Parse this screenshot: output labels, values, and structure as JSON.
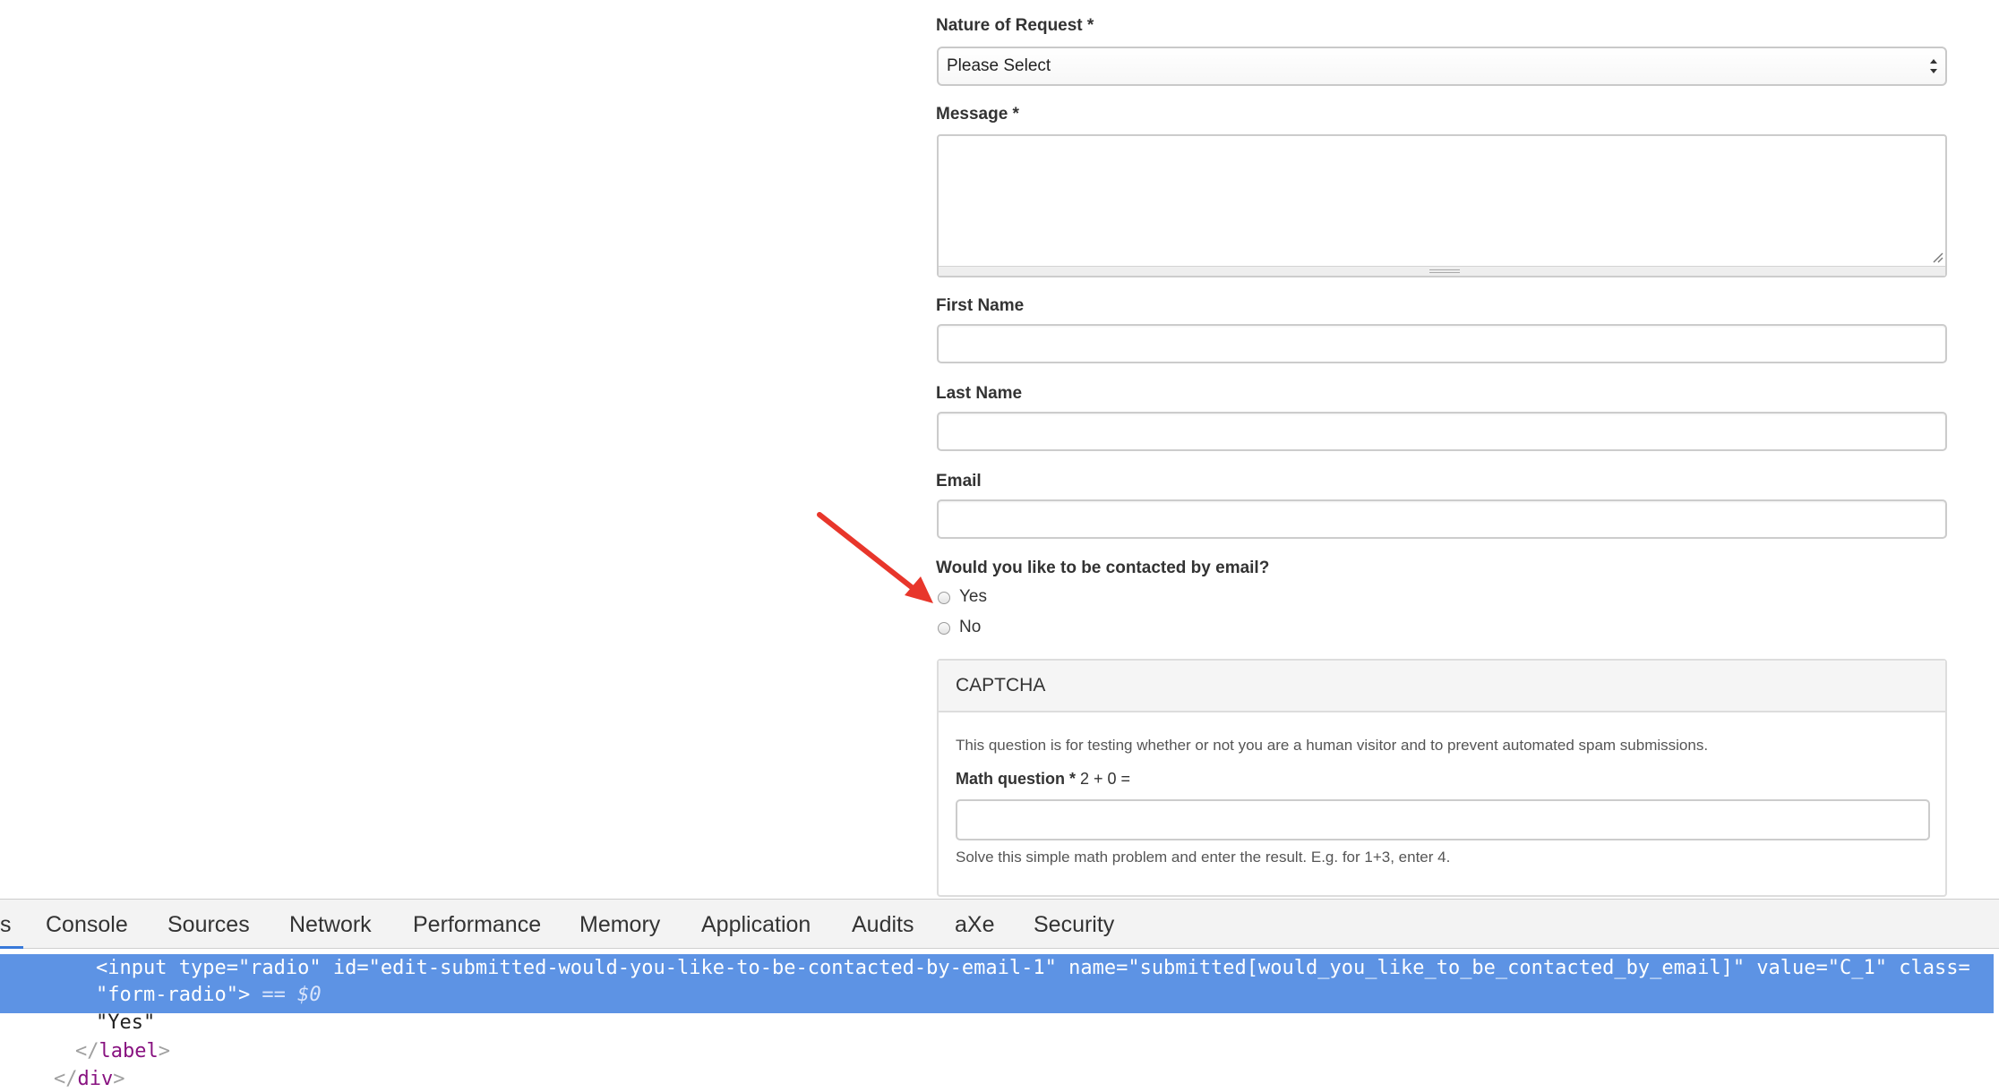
{
  "form": {
    "nature_label": "Nature of Request *",
    "nature_select_value": "Please Select",
    "message_label": "Message *",
    "first_name_label": "First Name",
    "last_name_label": "Last Name",
    "email_label": "Email",
    "contact_question": "Would you like to be contacted by email?",
    "options": [
      {
        "label": "Yes",
        "selected": false
      },
      {
        "label": "No",
        "selected": false
      }
    ]
  },
  "captcha": {
    "title": "CAPTCHA",
    "description": "This question is for testing whether or not you are a human visitor and to prevent automated spam submissions.",
    "math_label": "Math question *",
    "math_expression": " 2 + 0 =",
    "help": "Solve this simple math problem and enter the result. E.g. for 1+3, enter 4."
  },
  "annotation": {
    "arrow_color": "#e8362b"
  },
  "devtools": {
    "first_tab_fragment": "s",
    "tabs": [
      "Console",
      "Sources",
      "Network",
      "Performance",
      "Memory",
      "Application",
      "Audits",
      "aXe",
      "Security"
    ],
    "selected_line_1": "<input type=\"radio\" id=\"edit-submitted-would-you-like-to-be-contacted-by-email-1\" name=\"submitted[would_you_like_to_be_contacted_by_email]\" value=\"C_1\" class=",
    "selected_line_2": "\"form-radio\">",
    "selected_suffix": " == $0",
    "text_node": "\"Yes\"",
    "close_label_tag": "label",
    "close_div_tag": "div",
    "selection_color": "#5d93e4"
  }
}
